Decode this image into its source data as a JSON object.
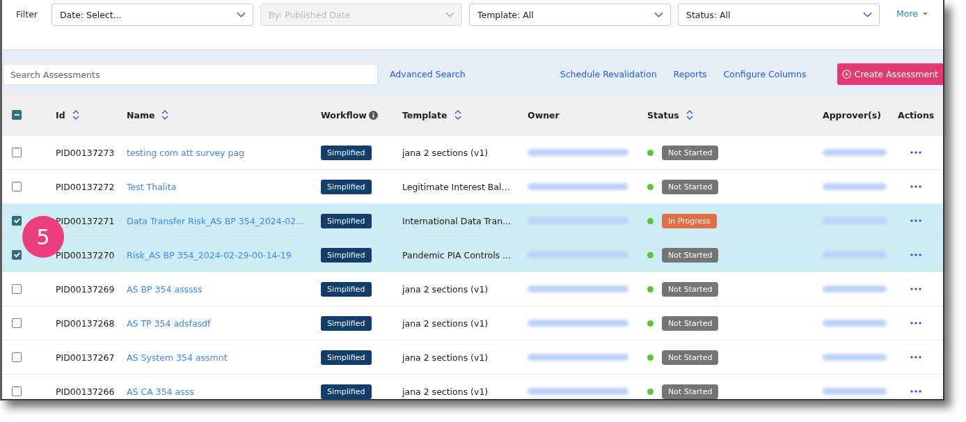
{
  "filter_bar": {
    "label": "Filter",
    "dropdowns": [
      {
        "value": "Date: Select...",
        "disabled": false
      },
      {
        "value": "By: Published Date",
        "disabled": true
      },
      {
        "value": "Template: All",
        "disabled": false
      },
      {
        "value": "Status: All",
        "disabled": false
      }
    ],
    "more": "More"
  },
  "toolbar": {
    "search": {
      "placeholder": "Search Assessments"
    },
    "advanced_search": "Advanced Search",
    "links": [
      "Schedule Revalidation",
      "Reports",
      "Configure Columns"
    ],
    "create_button": "Create Assessment"
  },
  "table": {
    "select_all": {
      "indeterminate": true
    },
    "columns": [
      {
        "label": "Id",
        "kind": "sortable"
      },
      {
        "label": "Name",
        "kind": "sortable"
      },
      {
        "label": "Workflow",
        "kind": "info"
      },
      {
        "label": "Template",
        "kind": "sortable"
      },
      {
        "label": "Owner",
        "kind": "plain"
      },
      {
        "label": "Status",
        "kind": "sortable"
      },
      {
        "label": "Approver(s)",
        "kind": "plain"
      },
      {
        "label": "Actions",
        "kind": "plain"
      }
    ],
    "rows": [
      {
        "selected": false,
        "id": "PID00137273",
        "name": "testing com att survey pag",
        "workflow": "Simplified",
        "template": "jana 2 sections (v1)",
        "status": {
          "label": "Not Started",
          "color": "#757575"
        }
      },
      {
        "selected": false,
        "id": "PID00137272",
        "name": "Test Thalita",
        "workflow": "Simplified",
        "template": "Legitimate Interest Bal…",
        "status": {
          "label": "Not Started",
          "color": "#757575"
        }
      },
      {
        "selected": true,
        "id": "PID00137271",
        "name": "Data Transfer Risk_AS BP 354_2024-02…",
        "workflow": "Simplified",
        "template": "International Data Tran…",
        "status": {
          "label": "In Progress",
          "color": "#e06f45"
        }
      },
      {
        "selected": true,
        "id": "PID00137270",
        "name": "Risk_AS BP 354_2024-02-29-00-14-19",
        "workflow": "Simplified",
        "template": "Pandemic PIA Controls …",
        "status": {
          "label": "Not Started",
          "color": "#757575"
        }
      },
      {
        "selected": false,
        "id": "PID00137269",
        "name": "AS BP 354 asssss",
        "workflow": "Simplified",
        "template": "jana 2 sections (v1)",
        "status": {
          "label": "Not Started",
          "color": "#757575"
        }
      },
      {
        "selected": false,
        "id": "PID00137268",
        "name": "AS TP 354 adsfasdf",
        "workflow": "Simplified",
        "template": "jana 2 sections (v1)",
        "status": {
          "label": "Not Started",
          "color": "#757575"
        }
      },
      {
        "selected": false,
        "id": "PID00137267",
        "name": "AS System 354 assmnt",
        "workflow": "Simplified",
        "template": "jana 2 sections (v1)",
        "status": {
          "label": "Not Started",
          "color": "#757575"
        }
      },
      {
        "selected": false,
        "id": "PID00137266",
        "name": "AS CA 354 asss",
        "workflow": "Simplified",
        "template": "jana 2 sections (v1)",
        "status": {
          "label": "Not Started",
          "color": "#757575"
        }
      }
    ]
  },
  "annotation": {
    "label": "5"
  }
}
